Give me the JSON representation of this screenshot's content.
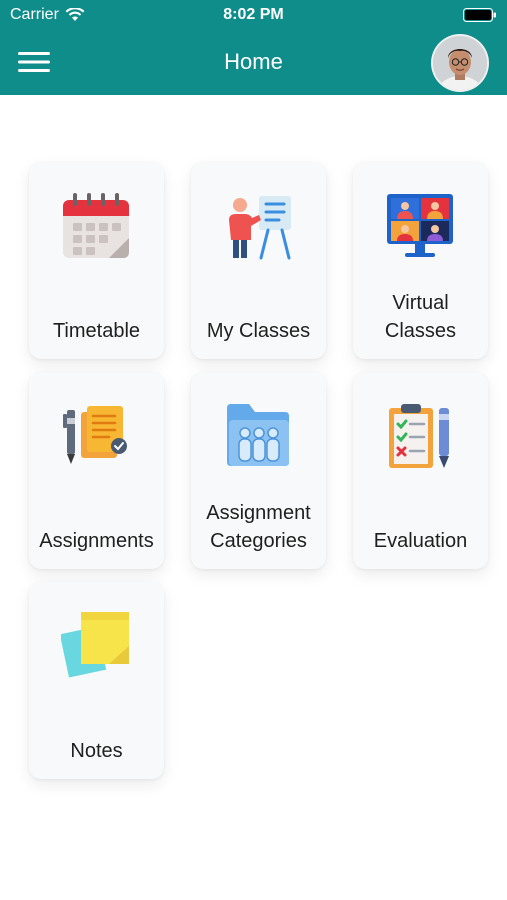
{
  "status_bar": {
    "carrier": "Carrier",
    "time": "8:02 PM",
    "icons": [
      "wifi-icon",
      "battery-icon"
    ]
  },
  "header": {
    "title": "Home",
    "menu_icon": "hamburger-menu-icon",
    "avatar": "user-avatar",
    "color": "#0f8d8b"
  },
  "tiles": [
    {
      "label": "Timetable",
      "icon": "calendar-icon"
    },
    {
      "label": "My Classes",
      "icon": "teacher-board-icon"
    },
    {
      "label": "Virtual\nClasses",
      "icon": "video-conference-icon"
    },
    {
      "label": "Assignments",
      "icon": "documents-pen-icon"
    },
    {
      "label": "Assignment\nCategories",
      "icon": "folder-group-icon"
    },
    {
      "label": "Evaluation",
      "icon": "clipboard-checklist-icon"
    },
    {
      "label": "Notes",
      "icon": "sticky-notes-icon"
    }
  ]
}
